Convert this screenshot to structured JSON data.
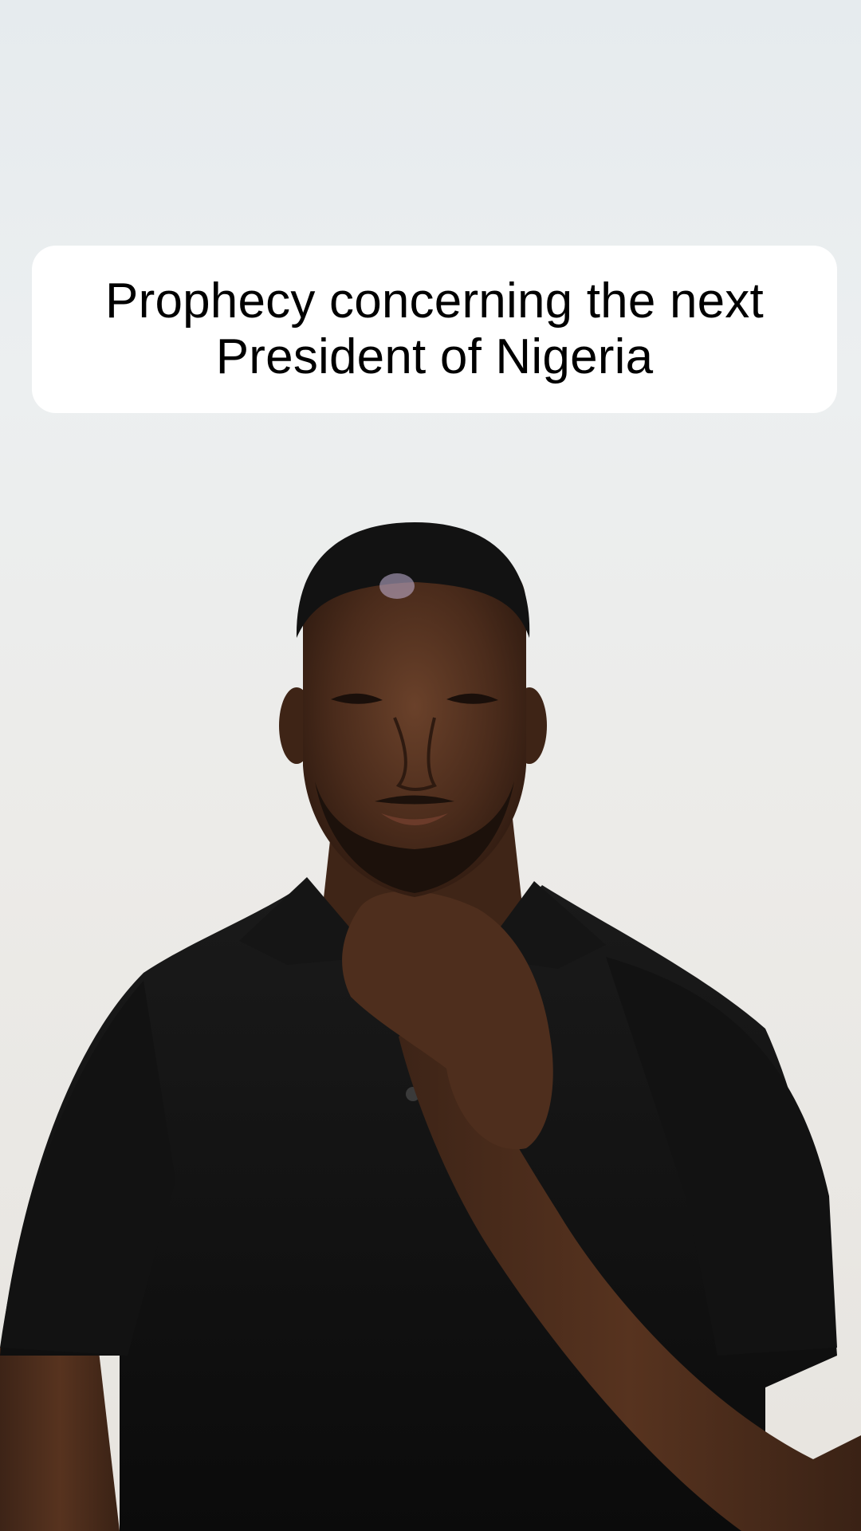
{
  "caption": {
    "text": "Prophecy concerning the next President of Nigeria"
  },
  "scene": {
    "subject": "man-in-black-polo",
    "background_color": "#e9e9e7",
    "shirt_color": "#111111",
    "skin_color": "#4a2c1c"
  }
}
